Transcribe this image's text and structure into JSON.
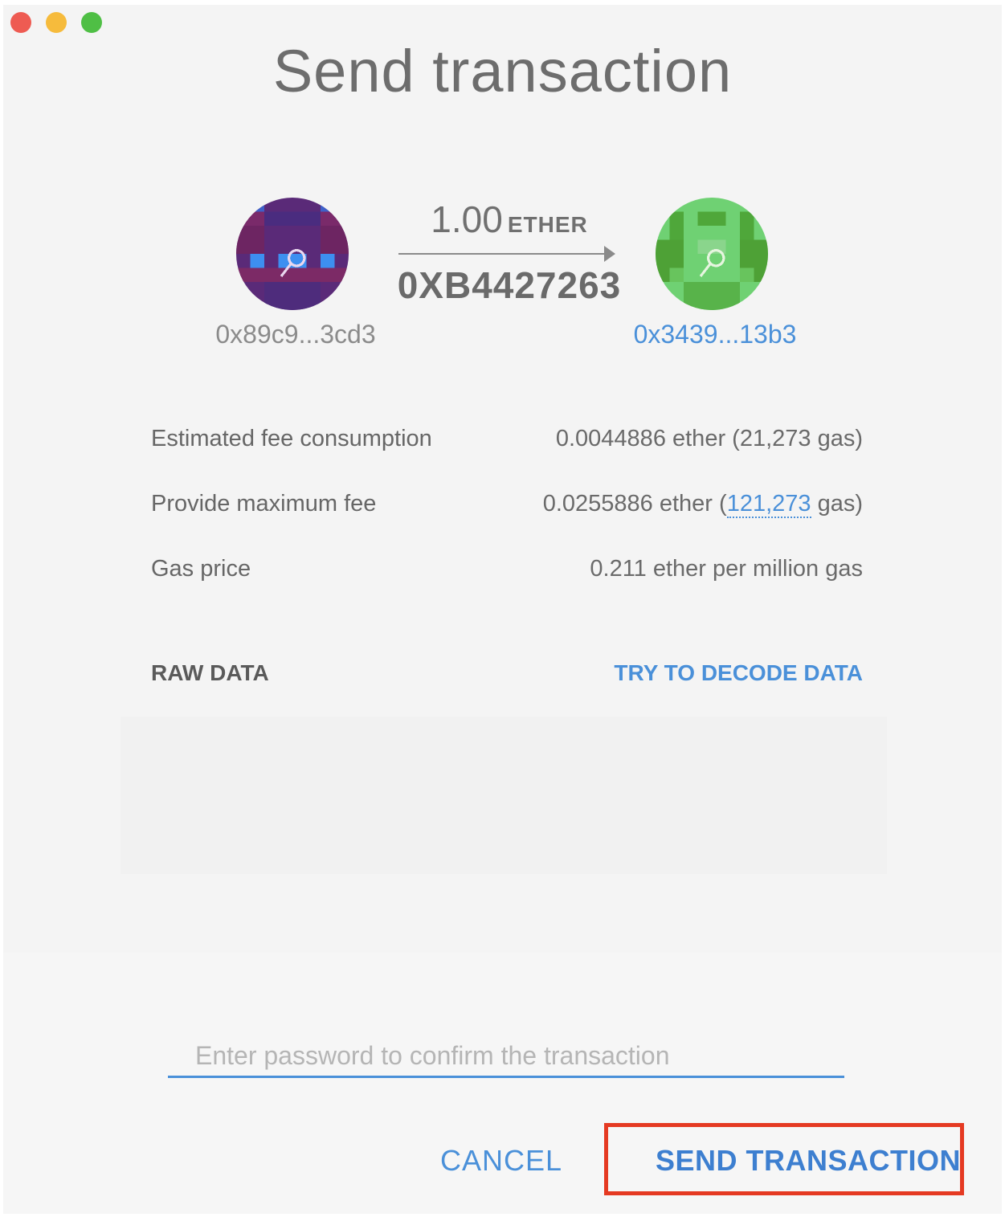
{
  "window": {
    "title": "Send transaction",
    "controls": [
      "close",
      "minimize",
      "zoom"
    ]
  },
  "transaction": {
    "from_address": "0x89c9...3cd3",
    "to_address": "0x3439...13b3",
    "amount": "1.00",
    "unit": "ETHER",
    "to_label": "0XB4427263",
    "from_identicon": "purple-identicon",
    "to_identicon": "green-identicon"
  },
  "details": [
    {
      "label": "Estimated fee consumption",
      "value_prefix": "0.0044886 ether (21,273 gas)",
      "link": "",
      "value_suffix": ""
    },
    {
      "label": "Provide maximum fee",
      "value_prefix": "0.0255886 ether (",
      "link": "121,273",
      "value_suffix": " gas)"
    },
    {
      "label": "Gas price",
      "value_prefix": "0.211 ether per million gas",
      "link": "",
      "value_suffix": ""
    }
  ],
  "raw_data": {
    "label": "RAW DATA",
    "decode_link": "TRY TO DECODE DATA"
  },
  "password": {
    "placeholder": "Enter password to confirm the transaction",
    "value": ""
  },
  "actions": {
    "cancel": "CANCEL",
    "send": "SEND TRANSACTION"
  },
  "colors": {
    "accent": "#4a90d9",
    "highlight": "#e53a22"
  }
}
